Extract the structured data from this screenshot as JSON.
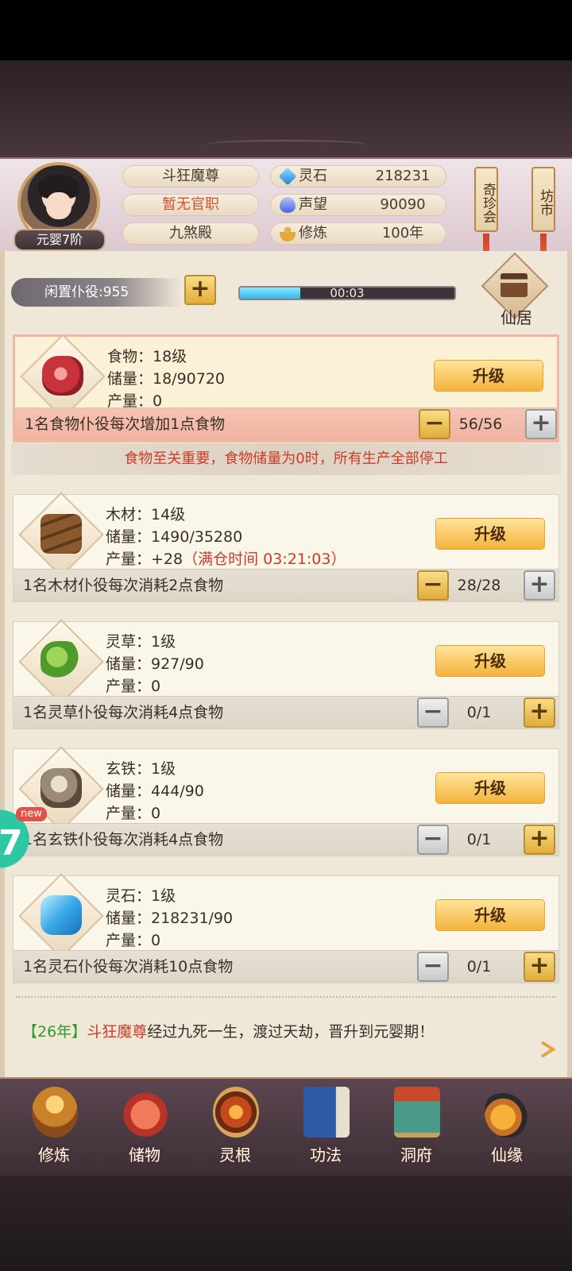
{
  "player": {
    "name": "斗狂魔尊",
    "official_rank": "暂无官职",
    "sect": "九煞殿",
    "level_badge": "元婴7阶"
  },
  "resources": [
    {
      "icon": "spirit-stone-icon",
      "label": "灵石",
      "value": "218231"
    },
    {
      "icon": "prestige-icon",
      "label": "声望",
      "value": "90090"
    },
    {
      "icon": "meditation-icon",
      "label": "修炼",
      "value": "100年"
    }
  ],
  "side_buttons": {
    "treasure_fair": "奇珍会",
    "market": "坊市"
  },
  "idle": {
    "label": "闲置仆役:955",
    "timer": "00:03",
    "progress": 0.28
  },
  "residence": {
    "label": "仙居"
  },
  "cards": [
    {
      "name": "食物：18级",
      "storage": "储量：18/90720",
      "output": "产量：0",
      "output_extra": "",
      "upgrade": "升级",
      "desc": "1名食物仆役每次增加1点食物",
      "count": "56/56"
    },
    {
      "name": "木材：14级",
      "storage": "储量：1490/35280",
      "output": "产量：+28",
      "output_extra": "（满仓时间 03:21:03）",
      "upgrade": "升级",
      "desc": "1名木材仆役每次消耗2点食物",
      "count": "28/28"
    },
    {
      "name": "灵草：1级",
      "storage": "储量：927/90",
      "output": "产量：0",
      "output_extra": "",
      "upgrade": "升级",
      "desc": "1名灵草仆役每次消耗4点食物",
      "count": "0/1"
    },
    {
      "name": "玄铁：1级",
      "storage": "储量：444/90",
      "output": "产量：0",
      "output_extra": "",
      "upgrade": "升级",
      "desc": "1名玄铁仆役每次消耗4点食物",
      "count": "0/1"
    },
    {
      "name": "灵石：1级",
      "storage": "储量：218231/90",
      "output": "产量：0",
      "output_extra": "",
      "upgrade": "升级",
      "desc": "1名灵石仆役每次消耗10点食物",
      "count": "0/1"
    }
  ],
  "warning": "食物至关重要，食物储量为0时，所有生产全部停工",
  "log": {
    "year": "【26年】",
    "name": "斗狂魔尊",
    "text": "经过九死一生，渡过天劫，晋升到元婴期！"
  },
  "badge": {
    "new": "new",
    "number": "7"
  },
  "nav": [
    {
      "label": "修炼",
      "icon": "cultivation-icon"
    },
    {
      "label": "储物",
      "icon": "storage-bag-icon"
    },
    {
      "label": "灵根",
      "icon": "spirit-root-icon"
    },
    {
      "label": "功法",
      "icon": "technique-book-icon"
    },
    {
      "label": "洞府",
      "icon": "cave-mansion-icon"
    },
    {
      "label": "仙缘",
      "icon": "fortune-gourd-icon"
    }
  ],
  "colors": {
    "accent": "#f3b33b",
    "warning_red": "#cc3b2a",
    "log_green": "#2f9a2d"
  }
}
